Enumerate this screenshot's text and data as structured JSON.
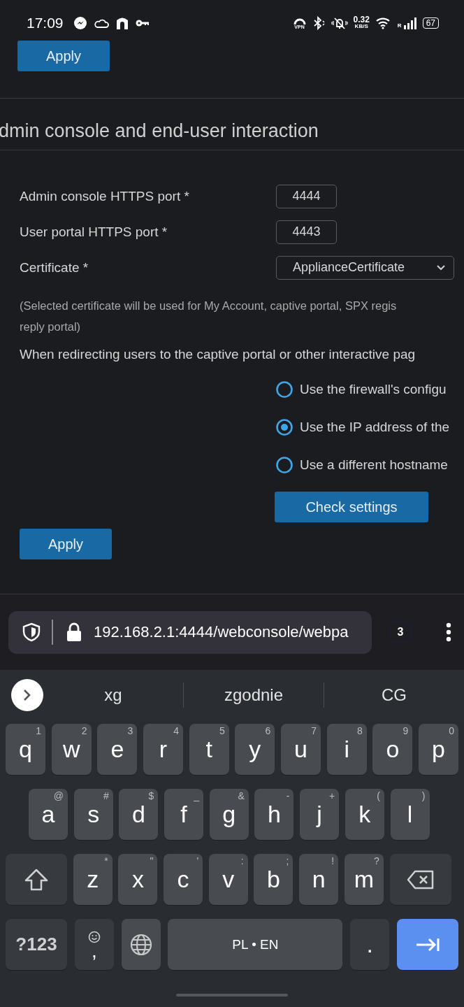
{
  "status_bar": {
    "time": "17:09",
    "vpn_label": "VPN",
    "network_speed": "0.32",
    "speed_unit": "KB/S",
    "roaming_label": "R",
    "battery": "67"
  },
  "top_apply_button": "Apply",
  "section": {
    "title": "dmin console and end-user interaction",
    "fields": [
      {
        "label": "Admin console HTTPS port *",
        "kind": "text",
        "value": "4444"
      },
      {
        "label": "User portal HTTPS port *",
        "kind": "text",
        "value": "4443"
      },
      {
        "label": "Certificate *",
        "kind": "select",
        "value": "ApplianceCertificate"
      }
    ],
    "note_lines": [
      "(Selected certificate will be used for My Account, captive portal, SPX regis",
      "reply portal)"
    ],
    "redirect_prompt": "When redirecting users to the captive portal or other interactive pag",
    "redirect_options": [
      {
        "label": "Use the firewall's configu",
        "selected": false
      },
      {
        "label": "Use the IP address of the",
        "selected": true
      },
      {
        "label": "Use a different hostname",
        "selected": false
      }
    ],
    "check_button": "Check settings",
    "apply_button": "Apply"
  },
  "browser": {
    "url": "192.168.2.1:4444/webconsole/webpa",
    "tab_count": "3"
  },
  "keyboard": {
    "suggestions": [
      "xg",
      "zgodnie",
      "CG"
    ],
    "top_row": [
      {
        "kind": "letter",
        "label": "q",
        "hint": "1"
      },
      {
        "kind": "letter",
        "label": "w",
        "hint": "2"
      },
      {
        "kind": "letter",
        "label": "e",
        "hint": "3"
      },
      {
        "kind": "letter",
        "label": "r",
        "hint": "4"
      },
      {
        "kind": "letter",
        "label": "t",
        "hint": "5"
      },
      {
        "kind": "letter",
        "label": "y",
        "hint": "6"
      },
      {
        "kind": "letter",
        "label": "u",
        "hint": "7"
      },
      {
        "kind": "letter",
        "label": "i",
        "hint": "8"
      },
      {
        "kind": "letter",
        "label": "o",
        "hint": "9"
      },
      {
        "kind": "letter",
        "label": "p",
        "hint": "0"
      }
    ],
    "middle_row": [
      {
        "kind": "letter",
        "label": "a",
        "hint": "@"
      },
      {
        "kind": "letter",
        "label": "s",
        "hint": "#"
      },
      {
        "kind": "letter",
        "label": "d",
        "hint": "$"
      },
      {
        "kind": "letter",
        "label": "f",
        "hint": "_"
      },
      {
        "kind": "letter",
        "label": "g",
        "hint": "&"
      },
      {
        "kind": "letter",
        "label": "h",
        "hint": "-"
      },
      {
        "kind": "letter",
        "label": "j",
        "hint": "+"
      },
      {
        "kind": "letter",
        "label": "k",
        "hint": "("
      },
      {
        "kind": "letter",
        "label": "l",
        "hint": ")"
      }
    ],
    "bottom_row": [
      {
        "kind": "shift"
      },
      {
        "kind": "letter",
        "label": "z",
        "hint": "*"
      },
      {
        "kind": "letter",
        "label": "x",
        "hint": "\""
      },
      {
        "kind": "letter",
        "label": "c",
        "hint": "'"
      },
      {
        "kind": "letter",
        "label": "v",
        "hint": ":"
      },
      {
        "kind": "letter",
        "label": "b",
        "hint": ";"
      },
      {
        "kind": "letter",
        "label": "n",
        "hint": "!"
      },
      {
        "kind": "letter",
        "label": "m",
        "hint": "?"
      },
      {
        "kind": "backspace"
      }
    ],
    "function_row": [
      {
        "kind": "symbols",
        "label": "?123"
      },
      {
        "kind": "comma",
        "label": ","
      },
      {
        "kind": "globe"
      },
      {
        "kind": "space",
        "label": "PL • EN"
      },
      {
        "kind": "period",
        "label": "."
      },
      {
        "kind": "enter"
      }
    ]
  }
}
